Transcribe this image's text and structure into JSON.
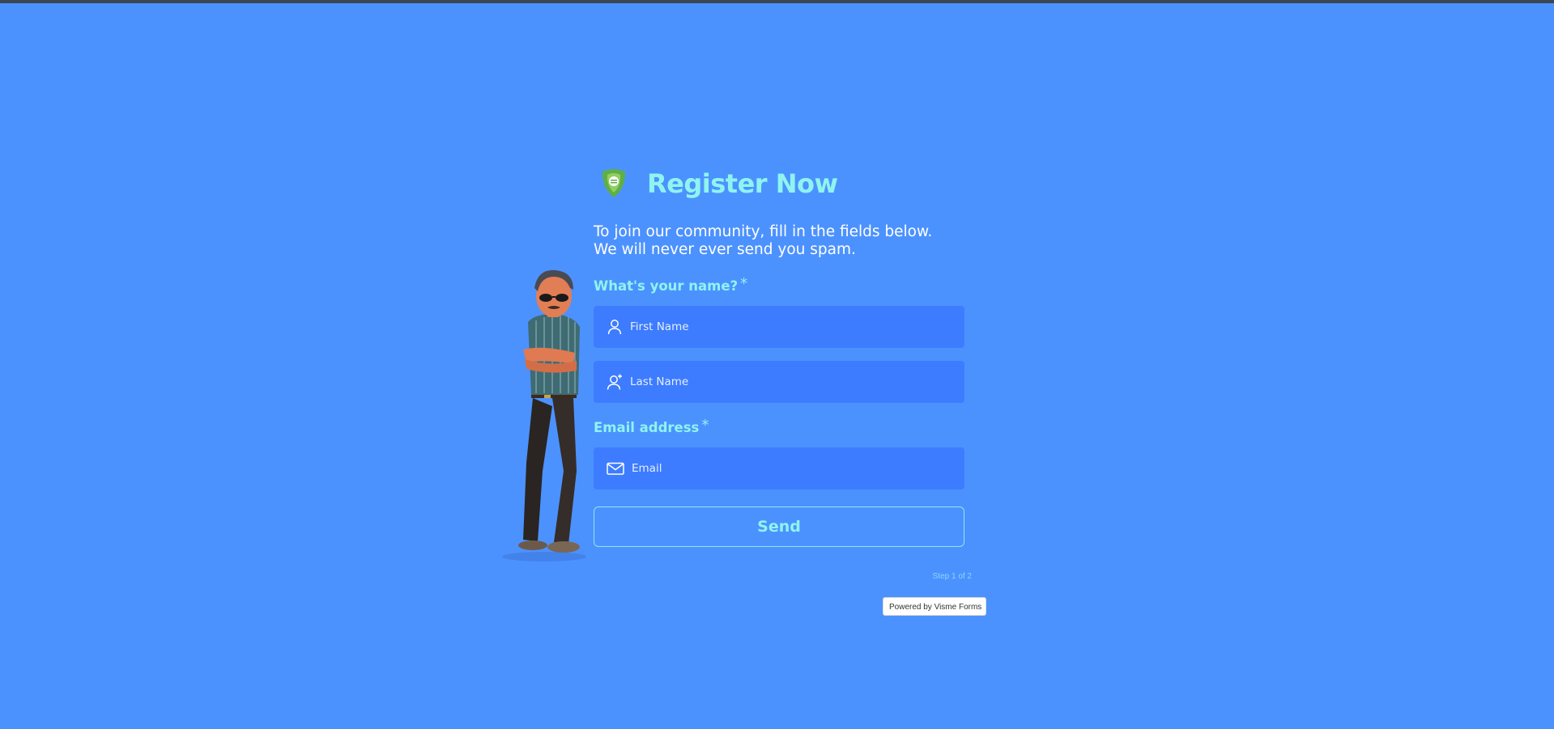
{
  "form": {
    "title": "Register Now",
    "intro_line1": "To join our community, fill in the fields below.",
    "intro_line2": "We will never ever send you spam.",
    "name_label": "What's your name?",
    "required_mark": "*",
    "first_name_placeholder": "First Name",
    "last_name_placeholder": "Last Name",
    "email_label": "Email address",
    "email_placeholder": "Email",
    "send_label": "Send",
    "step_text": "Step 1 of 2"
  },
  "footer": {
    "powered_by": "Powered by Visme Forms"
  },
  "icons": {
    "logo": "shield-logo-icon",
    "first_name": "user-icon",
    "last_name": "user-plus-icon",
    "email": "envelope-icon"
  },
  "colors": {
    "background": "#4c92ff",
    "field_background": "#3d7cff",
    "accent": "#8ff4ee"
  }
}
